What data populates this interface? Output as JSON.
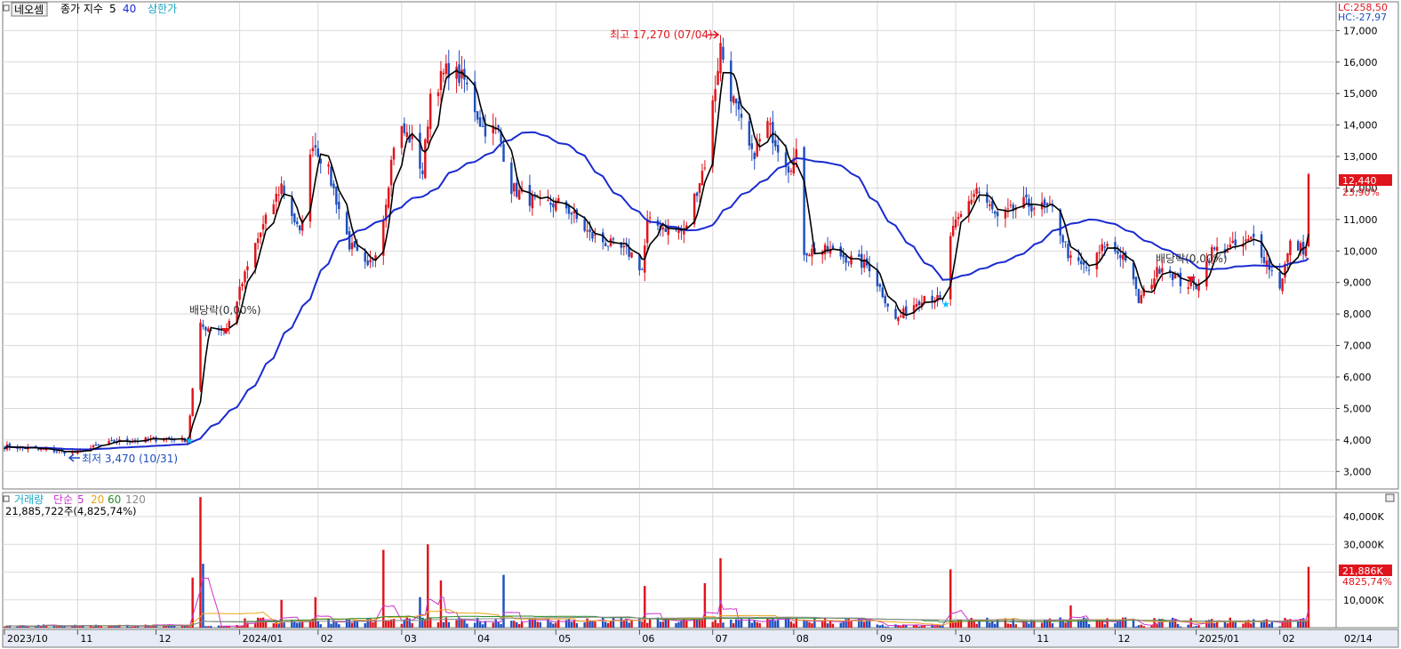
{
  "header": {
    "stock_name": "네오셈",
    "indicator_label": "종가 지수",
    "ma_short": "5",
    "ma_long": "40",
    "limit_label": "상한가"
  },
  "right_top": {
    "lc": "LC:258,50",
    "hc": "HC:-27,97"
  },
  "price_tag": {
    "price": "12,440",
    "change": "23,90%"
  },
  "volume_header": {
    "title": "거래량",
    "ma_label": "단순",
    "periods": [
      "5",
      "20",
      "60",
      "120"
    ],
    "current": "21,885,722주(4,825,74%)"
  },
  "volume_tag": {
    "value": "21,886K",
    "pct": "4825,74%"
  },
  "annotations": {
    "high": "최고 17,270 (07/04)",
    "low": "최저 3,470 (10/31)",
    "dividend1": "배당락(0,00%)",
    "dividend2": "배당락(0,00%)"
  },
  "date_label": "02/14",
  "colors": {
    "up": "#e0141c",
    "down": "#1f4fbf",
    "ma5": "#000000",
    "ma40": "#1a2bd0",
    "vol_ma5": "#cc33cc",
    "vol_ma20": "#e8a317",
    "vol_ma60": "#2a8a2a",
    "vol_ma120": "#888888",
    "grid": "#d9d9d9"
  },
  "chart_data": {
    "type": "candlestick",
    "price_axis": {
      "ticks": [
        "3,000",
        "4,000",
        "5,000",
        "6,000",
        "7,000",
        "8,000",
        "9,000",
        "10,000",
        "11,000",
        "12,000",
        "13,000",
        "14,000",
        "15,000",
        "16,000",
        "17,000"
      ],
      "range": [
        2500,
        17800
      ]
    },
    "volume_axis": {
      "ticks": [
        "10,000K",
        "20,000K",
        "30,000K",
        "40,000K"
      ],
      "range": [
        0,
        48000
      ]
    },
    "x_labels": [
      "2023/10",
      "11",
      "12",
      "2024/01",
      "02",
      "03",
      "04",
      "05",
      "06",
      "07",
      "08",
      "09",
      "10",
      "11",
      "12",
      "2025/01",
      "02"
    ],
    "close_keypoints": [
      {
        "x": "2023-10-04",
        "close": 3800
      },
      {
        "x": "2023-10-31",
        "close": 3600
      },
      {
        "x": "2023-11-15",
        "close": 3950
      },
      {
        "x": "2023-12-05",
        "close": 4050
      },
      {
        "x": "2023-12-13",
        "close": 4000
      },
      {
        "x": "2023-12-15",
        "close": 5600
      },
      {
        "x": "2023-12-18",
        "close": 7600
      },
      {
        "x": "2023-12-28",
        "close": 7500
      },
      {
        "x": "2024-01-08",
        "close": 10200
      },
      {
        "x": "2024-01-18",
        "close": 12100
      },
      {
        "x": "2024-01-25",
        "close": 10500
      },
      {
        "x": "2024-01-30",
        "close": 13500
      },
      {
        "x": "2024-02-05",
        "close": 12500
      },
      {
        "x": "2024-02-13",
        "close": 10200
      },
      {
        "x": "2024-02-20",
        "close": 9400
      },
      {
        "x": "2024-02-25",
        "close": 10500
      },
      {
        "x": "2024-03-02",
        "close": 14000
      },
      {
        "x": "2024-03-08",
        "close": 13500
      },
      {
        "x": "2024-03-12",
        "close": 12500
      },
      {
        "x": "2024-03-15",
        "close": 15000
      },
      {
        "x": "2024-03-22",
        "close": 15800
      },
      {
        "x": "2024-03-28",
        "close": 15400
      },
      {
        "x": "2024-04-04",
        "close": 13900
      },
      {
        "x": "2024-04-10",
        "close": 13800
      },
      {
        "x": "2024-04-15",
        "close": 12000
      },
      {
        "x": "2024-04-25",
        "close": 11500
      },
      {
        "x": "2024-05-05",
        "close": 11500
      },
      {
        "x": "2024-05-15",
        "close": 10500
      },
      {
        "x": "2024-05-31",
        "close": 9900
      },
      {
        "x": "2024-06-04",
        "close": 9400
      },
      {
        "x": "2024-06-06",
        "close": 10900
      },
      {
        "x": "2024-06-20",
        "close": 10600
      },
      {
        "x": "2024-06-28",
        "close": 12800
      },
      {
        "x": "2024-07-04",
        "close": 16500
      },
      {
        "x": "2024-07-08",
        "close": 15000
      },
      {
        "x": "2024-07-16",
        "close": 13000
      },
      {
        "x": "2024-07-22",
        "close": 14000
      },
      {
        "x": "2024-07-30",
        "close": 12700
      },
      {
        "x": "2024-08-02",
        "close": 13000
      },
      {
        "x": "2024-08-05",
        "close": 10000
      },
      {
        "x": "2024-08-15",
        "close": 10000
      },
      {
        "x": "2024-08-30",
        "close": 9500
      },
      {
        "x": "2024-09-09",
        "close": 7800
      },
      {
        "x": "2024-09-20",
        "close": 8600
      },
      {
        "x": "2024-09-27",
        "close": 8400
      },
      {
        "x": "2024-09-30",
        "close": 10500
      },
      {
        "x": "2024-10-10",
        "close": 12000
      },
      {
        "x": "2024-10-18",
        "close": 11000
      },
      {
        "x": "2024-10-28",
        "close": 11500
      },
      {
        "x": "2024-11-08",
        "close": 11300
      },
      {
        "x": "2024-11-15",
        "close": 9700
      },
      {
        "x": "2024-11-22",
        "close": 9400
      },
      {
        "x": "2024-11-28",
        "close": 10200
      },
      {
        "x": "2024-12-06",
        "close": 9800
      },
      {
        "x": "2024-12-11",
        "close": 8400
      },
      {
        "x": "2024-12-20",
        "close": 9600
      },
      {
        "x": "2024-12-27",
        "close": 9000
      },
      {
        "x": "2025-01-02",
        "close": 8900
      },
      {
        "x": "2025-01-08",
        "close": 10000
      },
      {
        "x": "2025-01-20",
        "close": 10200
      },
      {
        "x": "2025-01-24",
        "close": 10400
      },
      {
        "x": "2025-02-03",
        "close": 8900
      },
      {
        "x": "2025-02-07",
        "close": 10200
      },
      {
        "x": "2025-02-13",
        "close": 10040
      },
      {
        "x": "2025-02-14",
        "close": 12440
      }
    ],
    "volume_spikes_k": [
      {
        "x": "2023-12-15",
        "value": 18000
      },
      {
        "x": "2023-12-18",
        "value": 47000
      },
      {
        "x": "2023-12-19",
        "value": 23000
      },
      {
        "x": "2024-01-18",
        "value": 10000
      },
      {
        "x": "2024-01-31",
        "value": 11000
      },
      {
        "x": "2024-02-26",
        "value": 28000
      },
      {
        "x": "2024-03-11",
        "value": 11000
      },
      {
        "x": "2024-03-14",
        "value": 30000
      },
      {
        "x": "2024-03-19",
        "value": 17000
      },
      {
        "x": "2024-04-12",
        "value": 19000
      },
      {
        "x": "2024-06-05",
        "value": 15000
      },
      {
        "x": "2024-06-28",
        "value": 16000
      },
      {
        "x": "2024-07-04",
        "value": 25000
      },
      {
        "x": "2024-09-30",
        "value": 21000
      },
      {
        "x": "2024-11-15",
        "value": 8000
      },
      {
        "x": "2025-02-14",
        "value": 21886
      }
    ],
    "moving_averages": {
      "price": [
        "5",
        "40"
      ],
      "volume": [
        "5",
        "20",
        "60",
        "120"
      ]
    },
    "grid": true
  }
}
